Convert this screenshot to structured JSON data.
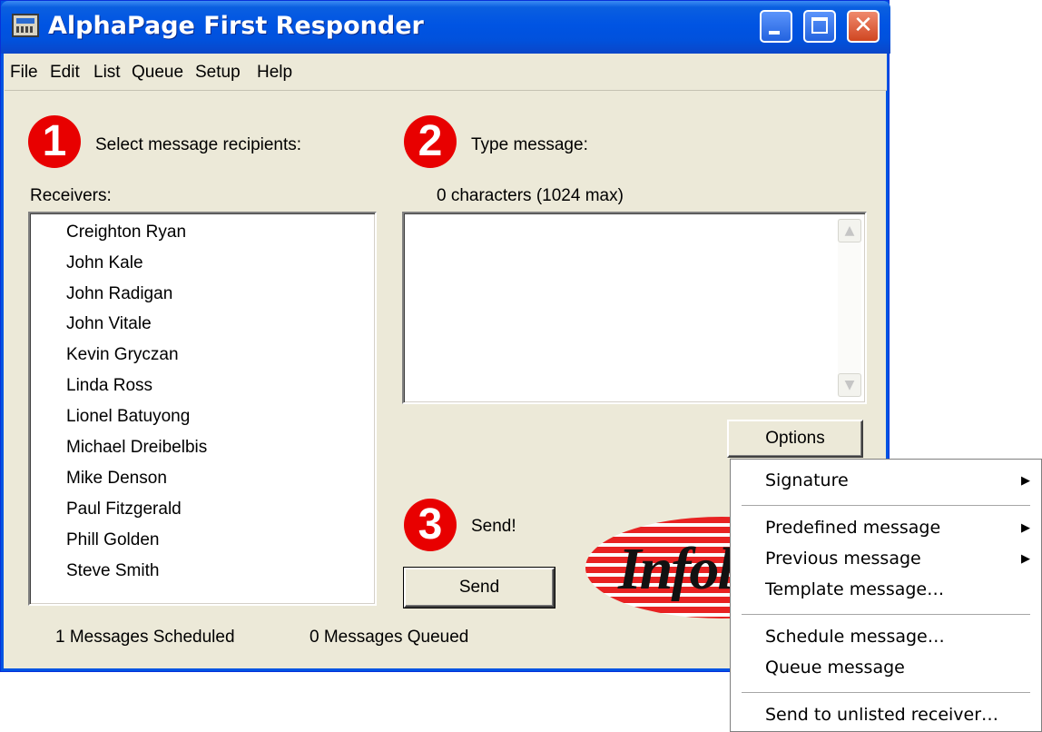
{
  "window": {
    "title": "AlphaPage First Responder"
  },
  "menubar": [
    "File",
    "Edit",
    "List",
    "Queue",
    "Setup",
    "Help"
  ],
  "step1": {
    "number": "1",
    "label": "Select message recipients:"
  },
  "step2": {
    "number": "2",
    "label": "Type message:"
  },
  "step3": {
    "number": "3",
    "label": "Send!"
  },
  "receivers": {
    "label": "Receivers:",
    "items": [
      "Creighton Ryan",
      "John Kale",
      "John Radigan",
      "John Vitale",
      "Kevin Gryczan",
      "Linda Ross",
      "Lionel Batuyong",
      "Michael Dreibelbis",
      "Mike Denson",
      "Paul Fitzgerald",
      "Phill Golden",
      "Steve Smith"
    ]
  },
  "message": {
    "char_count": "0 characters (1024  max)",
    "value": ""
  },
  "buttons": {
    "options": "Options",
    "send": "Send"
  },
  "logo_text": "Infol",
  "status": {
    "scheduled": "1  Messages Scheduled",
    "queued": "0  Messages Queued"
  },
  "options_menu": {
    "items": [
      {
        "label": "Signature",
        "submenu": true
      },
      {
        "label": "Predefined message",
        "submenu": true
      },
      {
        "label": "Previous message",
        "submenu": true
      },
      {
        "label": "Template message…",
        "submenu": false
      },
      {
        "label": "Schedule message…",
        "submenu": false
      },
      {
        "label": "Queue message",
        "submenu": false
      },
      {
        "label": "Send to unlisted receiver…",
        "submenu": false
      }
    ]
  },
  "colors": {
    "titlebar": "#0054e3",
    "dialog_bg": "#ece9d8",
    "step_badge": "#e80000"
  }
}
